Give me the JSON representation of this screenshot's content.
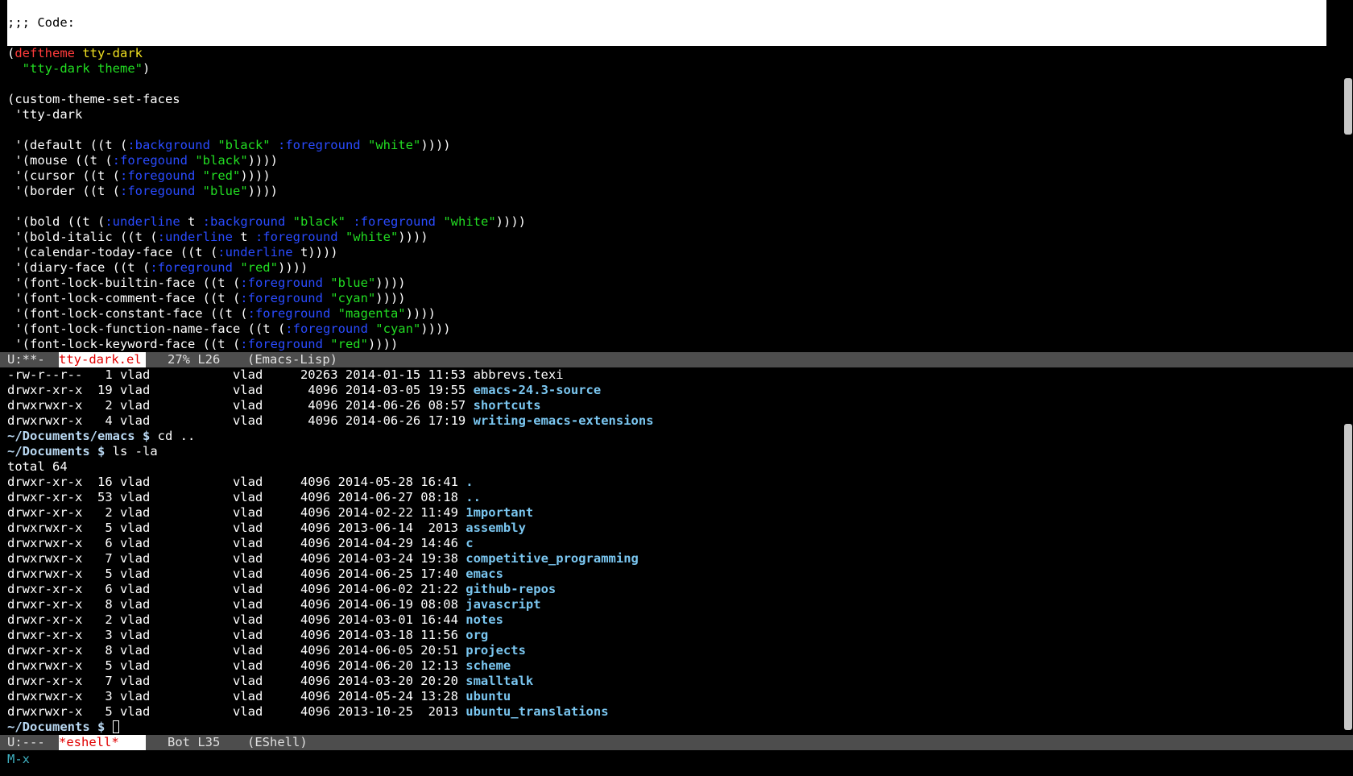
{
  "top_strip": {
    "text": ";;; Code:"
  },
  "code_window": {
    "lines": [
      [
        {
          "t": "("
        },
        {
          "t": "deftheme",
          "c": "kw"
        },
        {
          "t": " "
        },
        {
          "t": "tty-dark",
          "c": "fn"
        }
      ],
      [
        {
          "t": "  "
        },
        {
          "t": "\"tty-dark theme\"",
          "c": "str"
        },
        {
          "t": ")"
        }
      ],
      [
        {
          "t": ""
        }
      ],
      [
        {
          "t": "(custom-theme-set-faces"
        }
      ],
      [
        {
          "t": " 'tty-dark"
        }
      ],
      [
        {
          "t": ""
        }
      ],
      [
        {
          "t": " '(default ((t ("
        },
        {
          "t": ":background",
          "c": "key"
        },
        {
          "t": " "
        },
        {
          "t": "\"black\"",
          "c": "str"
        },
        {
          "t": " "
        },
        {
          "t": ":foreground",
          "c": "key"
        },
        {
          "t": " "
        },
        {
          "t": "\"white\"",
          "c": "str"
        },
        {
          "t": "))))"
        }
      ],
      [
        {
          "t": " '(mouse ((t ("
        },
        {
          "t": ":foregound",
          "c": "key"
        },
        {
          "t": " "
        },
        {
          "t": "\"black\"",
          "c": "str"
        },
        {
          "t": "))))"
        }
      ],
      [
        {
          "t": " '(cursor ((t ("
        },
        {
          "t": ":foregound",
          "c": "key"
        },
        {
          "t": " "
        },
        {
          "t": "\"red\"",
          "c": "str"
        },
        {
          "t": "))))"
        }
      ],
      [
        {
          "t": " '(border ((t ("
        },
        {
          "t": ":foregound",
          "c": "key"
        },
        {
          "t": " "
        },
        {
          "t": "\"blue\"",
          "c": "str"
        },
        {
          "t": "))))"
        }
      ],
      [
        {
          "t": ""
        }
      ],
      [
        {
          "t": " '(bold ((t ("
        },
        {
          "t": ":underline",
          "c": "key"
        },
        {
          "t": " t "
        },
        {
          "t": ":background",
          "c": "key"
        },
        {
          "t": " "
        },
        {
          "t": "\"black\"",
          "c": "str"
        },
        {
          "t": " "
        },
        {
          "t": ":foreground",
          "c": "key"
        },
        {
          "t": " "
        },
        {
          "t": "\"white\"",
          "c": "str"
        },
        {
          "t": "))))"
        }
      ],
      [
        {
          "t": " '(bold-italic ((t ("
        },
        {
          "t": ":underline",
          "c": "key"
        },
        {
          "t": " t "
        },
        {
          "t": ":foreground",
          "c": "key"
        },
        {
          "t": " "
        },
        {
          "t": "\"white\"",
          "c": "str"
        },
        {
          "t": "))))"
        }
      ],
      [
        {
          "t": " '(calendar-today-face ((t ("
        },
        {
          "t": ":underline",
          "c": "key"
        },
        {
          "t": " t))))"
        }
      ],
      [
        {
          "t": " '(diary-face ((t ("
        },
        {
          "t": ":foreground",
          "c": "key"
        },
        {
          "t": " "
        },
        {
          "t": "\"red\"",
          "c": "str"
        },
        {
          "t": "))))"
        }
      ],
      [
        {
          "t": " '(font-lock-builtin-face ((t ("
        },
        {
          "t": ":foreground",
          "c": "key"
        },
        {
          "t": " "
        },
        {
          "t": "\"blue\"",
          "c": "str"
        },
        {
          "t": "))))"
        }
      ],
      [
        {
          "t": " '(font-lock-comment-face ((t ("
        },
        {
          "t": ":foreground",
          "c": "key"
        },
        {
          "t": " "
        },
        {
          "t": "\"cyan\"",
          "c": "str"
        },
        {
          "t": "))))"
        }
      ],
      [
        {
          "t": " '(font-lock-constant-face ((t ("
        },
        {
          "t": ":foreground",
          "c": "key"
        },
        {
          "t": " "
        },
        {
          "t": "\"magenta\"",
          "c": "str"
        },
        {
          "t": "))))"
        }
      ],
      [
        {
          "t": " '(font-lock-function-name-face ((t ("
        },
        {
          "t": ":foreground",
          "c": "key"
        },
        {
          "t": " "
        },
        {
          "t": "\"cyan\"",
          "c": "str"
        },
        {
          "t": "))))"
        }
      ],
      [
        {
          "t": " '(font-lock-keyword-face ((t ("
        },
        {
          "t": ":foreground",
          "c": "key"
        },
        {
          "t": " "
        },
        {
          "t": "\"red\"",
          "c": "str"
        },
        {
          "t": "))))"
        }
      ]
    ]
  },
  "code_modeline": {
    "status": "U:**-",
    "buffer": "tty-dark.el",
    "position": "27% L26",
    "mode": "(Emacs-Lisp)"
  },
  "shell_window": {
    "lines": [
      [
        {
          "t": "-rw-r--r--   1 vlad           vlad     20263 2014-01-15 11:53 abbrevs.texi"
        }
      ],
      [
        {
          "t": "drwxr-xr-x  19 vlad           vlad      4096 2014-03-05 19:55 "
        },
        {
          "t": "emacs-24.3-source",
          "c": "dir"
        }
      ],
      [
        {
          "t": "drwxrwxr-x   2 vlad           vlad      4096 2014-06-26 08:57 "
        },
        {
          "t": "shortcuts",
          "c": "dir"
        }
      ],
      [
        {
          "t": "drwxrwxr-x   4 vlad           vlad      4096 2014-06-26 17:19 "
        },
        {
          "t": "writing-emacs-extensions",
          "c": "dir"
        }
      ],
      [
        {
          "t": "~/Documents/emacs $",
          "c": "prompt"
        },
        {
          "t": " cd .."
        }
      ],
      [
        {
          "t": "~/Documents $",
          "c": "prompt"
        },
        {
          "t": " ls -la"
        }
      ],
      [
        {
          "t": "total 64"
        }
      ],
      [
        {
          "t": "drwxr-xr-x  16 vlad           vlad     4096 2014-05-28 16:41 "
        },
        {
          "t": ".",
          "c": "dir"
        }
      ],
      [
        {
          "t": "drwxr-xr-x  53 vlad           vlad     4096 2014-06-27 08:18 "
        },
        {
          "t": "..",
          "c": "dir"
        }
      ],
      [
        {
          "t": "drwxr-xr-x   2 vlad           vlad     4096 2014-02-22 11:49 "
        },
        {
          "t": "1mportant",
          "c": "dir"
        }
      ],
      [
        {
          "t": "drwxrwxr-x   5 vlad           vlad     4096 2013-06-14  2013 "
        },
        {
          "t": "assembly",
          "c": "dir"
        }
      ],
      [
        {
          "t": "drwxrwxr-x   6 vlad           vlad     4096 2014-04-29 14:46 "
        },
        {
          "t": "c",
          "c": "dir"
        }
      ],
      [
        {
          "t": "drwxrwxr-x   7 vlad           vlad     4096 2014-03-24 19:38 "
        },
        {
          "t": "competitive_programming",
          "c": "dir"
        }
      ],
      [
        {
          "t": "drwxrwxr-x   5 vlad           vlad     4096 2014-06-25 17:40 "
        },
        {
          "t": "emacs",
          "c": "dir"
        }
      ],
      [
        {
          "t": "drwxr-xr-x   6 vlad           vlad     4096 2014-06-02 21:22 "
        },
        {
          "t": "github-repos",
          "c": "dir"
        }
      ],
      [
        {
          "t": "drwxr-xr-x   8 vlad           vlad     4096 2014-06-19 08:08 "
        },
        {
          "t": "javascript",
          "c": "dir"
        }
      ],
      [
        {
          "t": "drwxr-xr-x   2 vlad           vlad     4096 2014-03-01 16:44 "
        },
        {
          "t": "notes",
          "c": "dir"
        }
      ],
      [
        {
          "t": "drwxr-xr-x   3 vlad           vlad     4096 2014-03-18 11:56 "
        },
        {
          "t": "org",
          "c": "dir"
        }
      ],
      [
        {
          "t": "drwxr-xr-x   8 vlad           vlad     4096 2014-06-05 20:51 "
        },
        {
          "t": "projects",
          "c": "dir"
        }
      ],
      [
        {
          "t": "drwxrwxr-x   5 vlad           vlad     4096 2014-06-20 12:13 "
        },
        {
          "t": "scheme",
          "c": "dir"
        }
      ],
      [
        {
          "t": "drwxr-xr-x   7 vlad           vlad     4096 2014-03-20 20:20 "
        },
        {
          "t": "smalltalk",
          "c": "dir"
        }
      ],
      [
        {
          "t": "drwxrwxr-x   3 vlad           vlad     4096 2014-05-24 13:28 "
        },
        {
          "t": "ubuntu",
          "c": "dir"
        }
      ],
      [
        {
          "t": "drwxrwxr-x   5 vlad           vlad     4096 2013-10-25  2013 "
        },
        {
          "t": "ubuntu_translations",
          "c": "dir"
        }
      ],
      [
        {
          "t": "~/Documents $",
          "c": "prompt"
        },
        {
          "t": " "
        },
        {
          "cursor": true
        }
      ]
    ]
  },
  "shell_modeline": {
    "status": "U:---",
    "buffer": "*eshell*",
    "position": "Bot L35",
    "mode": "(EShell)"
  },
  "minibuffer": {
    "text": "M-x"
  },
  "colors": {
    "keyword": "#ff3b3b",
    "function_name": "#f0e020",
    "string": "#22dd22",
    "keyword_arg": "#2a4bff",
    "directory": "#7ac6f0",
    "modeline_bg": "#4d4d4d",
    "minibuffer_prompt": "#3fb0c0"
  }
}
